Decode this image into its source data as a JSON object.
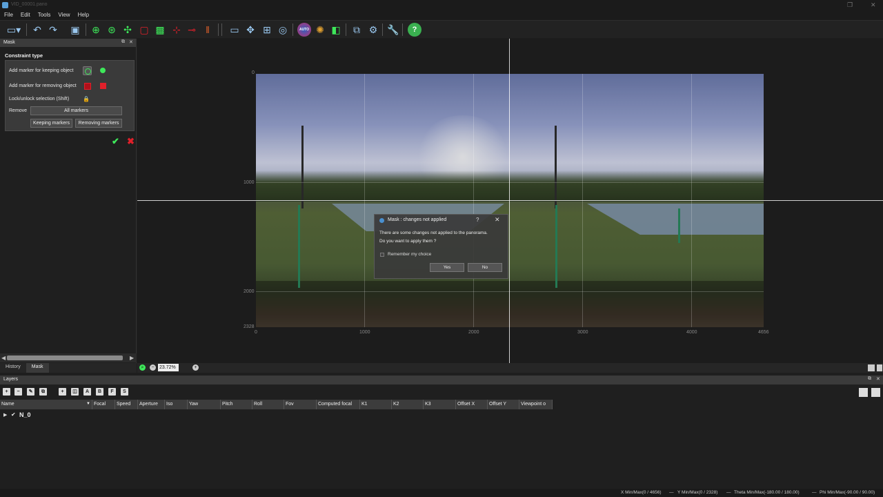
{
  "window": {
    "title": "VID_00001.pano"
  },
  "menu": [
    "File",
    "Edit",
    "Tools",
    "View",
    "Help"
  ],
  "toolbar": {
    "icons": [
      "monitor-dropdown-icon",
      "undo-icon",
      "redo-icon",
      "image-icon",
      "move-target-icon",
      "rotate-target-icon",
      "arrows-target-icon",
      "red-frame-icon",
      "green-frame-icon",
      "horizon-icon",
      "straighten-icon",
      "vertical-lines-icon",
      "preview-icon",
      "move-icon",
      "transform-icon",
      "globe-pointer-icon",
      "auto-color-icon",
      "color-wheel-icon",
      "layers-icon",
      "export-icon",
      "gear-icon",
      "wrench-icon",
      "help-icon"
    ],
    "auto_label": "AUTO"
  },
  "mask_panel": {
    "title": "Mask",
    "constraint_title": "Constraint type",
    "keep_label": "Add marker for keeping object",
    "remove_label": "Add marker for removing object",
    "lock_label": "Lock/unlock selection (Shift)",
    "remove_row_label": "Remove",
    "all_markers": "All markers",
    "keeping_markers": "Keeping markers",
    "removing_markers": "Removing markers"
  },
  "left_tabs": [
    "History",
    "Mask"
  ],
  "viewport": {
    "y_ticks": [
      "0",
      "1000",
      "2000",
      "2328"
    ],
    "x_ticks": [
      "0",
      "1000",
      "2000",
      "3000",
      "4000",
      "4656"
    ]
  },
  "dialog": {
    "title": "Mask : changes not applied",
    "help": "?",
    "close": "✕",
    "message_line1": "There are some changes not applied to the panorama.",
    "message_line2": "Do you want to apply them ?",
    "remember": "Remember my choice",
    "yes": "Yes",
    "no": "No"
  },
  "zoom": {
    "value": "23.72%"
  },
  "layers": {
    "title": "Layers",
    "tool_letters": [
      "A",
      "B",
      "F",
      "S"
    ],
    "columns": [
      "Name",
      "Focal",
      "Speed",
      "Aperture",
      "Iso",
      "Yaw",
      "Pitch",
      "Roll",
      "Fov",
      "Computed focal",
      "K1",
      "K2",
      "K3",
      "Offset X",
      "Offset Y",
      "Viewpoint o"
    ],
    "rows": [
      {
        "name": "N_0"
      }
    ]
  },
  "status": {
    "x": "X Min/Max(0 / 4656)",
    "sep": "—",
    "y": "Y Min/Max(0 / 2328)",
    "theta": "Theta Min/Max(-180.00 / 180.00)",
    "phi": "Phi Min/Max(-90.00 / 90.00)"
  },
  "colors": {
    "keep_marker": "#3ee85a",
    "remove_marker": "#e0202a",
    "apply": "#3ee85a",
    "cancel": "#e0202a"
  }
}
